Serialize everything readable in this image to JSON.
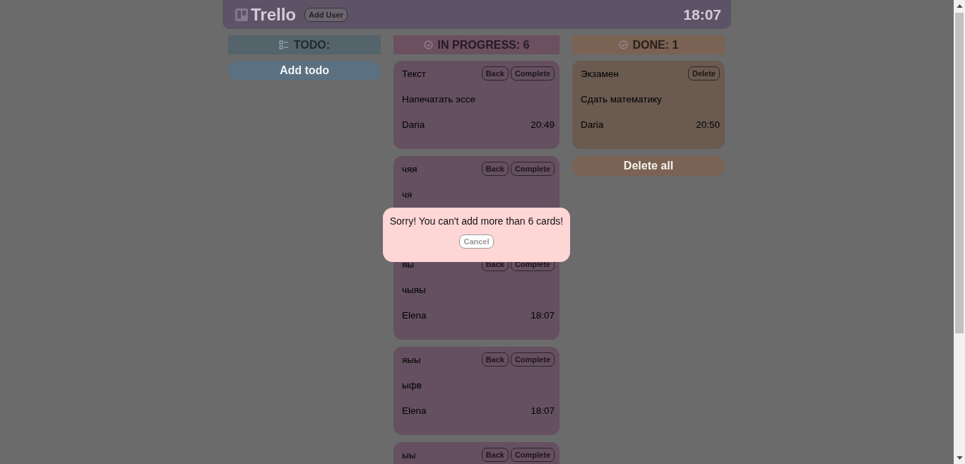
{
  "header": {
    "logo": "Trello",
    "add_user_button": "Add User",
    "time": "18:07"
  },
  "columns": [
    {
      "kind": "todo",
      "title": "TODO:",
      "color": "#55636b",
      "action": "Add todo"
    },
    {
      "kind": "in_progress",
      "title": "IN PROGRESS: 6",
      "color": "#6b5060",
      "cards": [
        {
          "title": "Текст",
          "description": "Напечатать эссе",
          "author": "Daria",
          "time": "20:49",
          "buttons": [
            "Back",
            "Complete"
          ]
        },
        {
          "title": "чяя",
          "description": "чя",
          "buttons": [
            "Back",
            "Complete"
          ]
        },
        {
          "title": "яы",
          "description": "чыяы",
          "author": "Elena",
          "time": "18:07",
          "buttons": [
            "Back",
            "Complete"
          ]
        },
        {
          "title": "яыы",
          "description": "ыфв",
          "author": "Elena",
          "time": "18:07",
          "buttons": [
            "Back",
            "Complete"
          ]
        },
        {
          "title": "ыы",
          "buttons": [
            "Back",
            "Complete"
          ]
        }
      ]
    },
    {
      "kind": "done",
      "title": "DONE: 1",
      "color": "#7a6355",
      "action": "Delete all",
      "cards": [
        {
          "title": "Экзамен",
          "description": "Сдать математику",
          "author": "Daria",
          "time": "20:50",
          "buttons": [
            "Delete"
          ]
        }
      ]
    }
  ],
  "modal": {
    "message": "Sorry! You can't add more than 6 cards!",
    "button": "Cancel"
  }
}
